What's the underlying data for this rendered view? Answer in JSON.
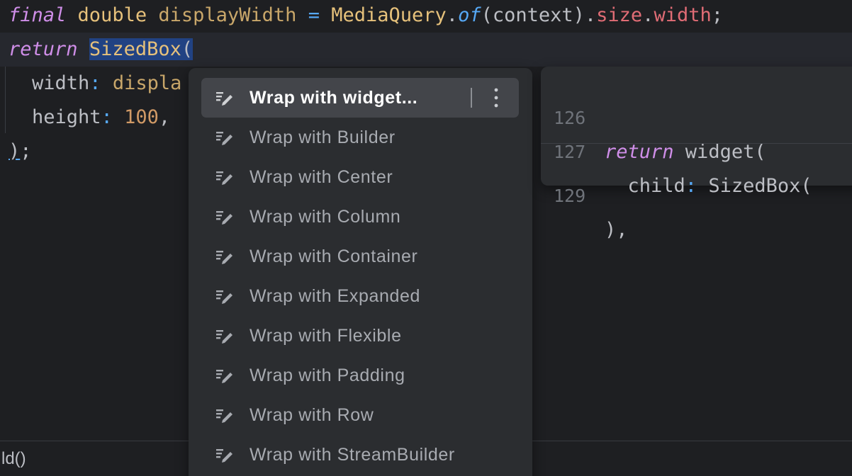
{
  "editor": {
    "line1": {
      "kw": "final",
      "type": "double",
      "var": "displayWidth",
      "op": "=",
      "cls": "MediaQuery",
      "dot": ".",
      "fn": "of",
      "args": "(context).",
      "prop1": "size",
      "dot2": ".",
      "prop2": "width",
      "end": ";"
    },
    "line2": {
      "kw": "return",
      "selected": "SizedBox",
      "paren": "("
    },
    "line3": {
      "name": "width",
      "colon": ":",
      "value": "displa"
    },
    "line4": {
      "name": "height",
      "colon": ":",
      "value": "100",
      "comma": ","
    },
    "line5": {
      "paren": ")",
      "semi": ";"
    }
  },
  "bottom_bar": {
    "text": "ld()"
  },
  "menu": {
    "items": [
      {
        "label": "Wrap with widget...",
        "icon": "wrap-edit-icon"
      },
      {
        "label": "Wrap with Builder",
        "icon": "wrap-edit-icon"
      },
      {
        "label": "Wrap with Center",
        "icon": "wrap-edit-icon"
      },
      {
        "label": "Wrap with Column",
        "icon": "wrap-edit-icon"
      },
      {
        "label": "Wrap with Container",
        "icon": "wrap-edit-icon"
      },
      {
        "label": "Wrap with Expanded",
        "icon": "wrap-edit-icon"
      },
      {
        "label": "Wrap with Flexible",
        "icon": "wrap-edit-icon"
      },
      {
        "label": "Wrap with Padding",
        "icon": "wrap-edit-icon"
      },
      {
        "label": "Wrap with Row",
        "icon": "wrap-edit-icon"
      },
      {
        "label": "Wrap with StreamBuilder",
        "icon": "wrap-edit-icon"
      }
    ],
    "more_icon": "more-vertical-icon"
  },
  "preview": {
    "lines": [
      {
        "num": "126",
        "kw": "return",
        "text": " widget("
      },
      {
        "num": "127",
        "name": "  child",
        "colon": ":",
        "text": " SizedBox("
      },
      {
        "num": "129",
        "text": "),"
      }
    ]
  },
  "colors": {
    "background": "#1e1f22",
    "keyword": "#cf8ee8",
    "type": "#e6c17b",
    "selection": "#214283",
    "menu_bg": "#2b2d30",
    "menu_active": "#43454a"
  }
}
